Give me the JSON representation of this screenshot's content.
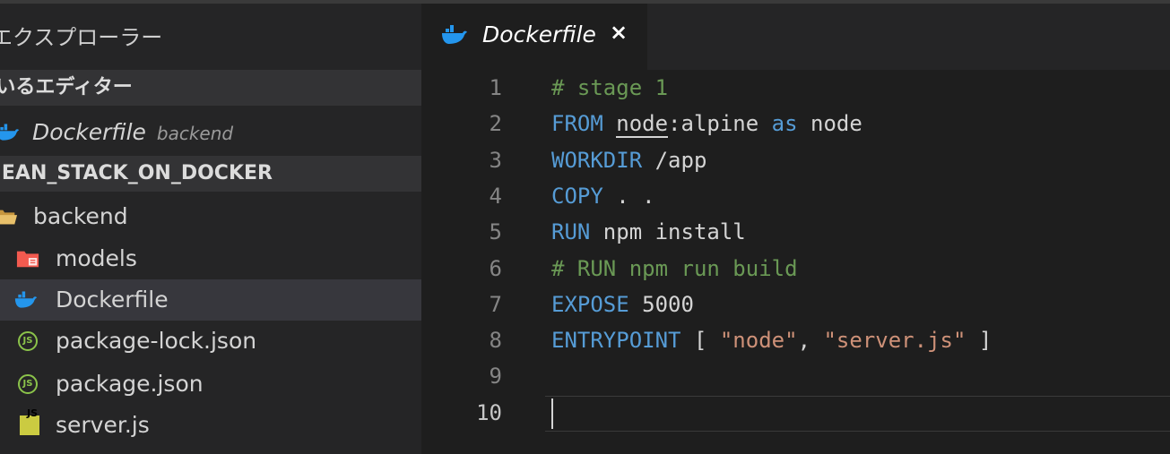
{
  "colors": {
    "keyword": "#569cd6",
    "comment": "#6a9955",
    "string": "#ce9178",
    "docker_icon": "#2496ed",
    "folder_icon": "#e8c06a",
    "models_folder_icon": "#f25a4f"
  },
  "sidebar": {
    "title": "エクスプローラー",
    "open_editors": {
      "header": "開いているエディター",
      "items": [
        {
          "label": "Dockerfile",
          "sub": "backend",
          "icon": "docker-icon"
        }
      ]
    },
    "project": {
      "header": "MEAN_STACK_ON_DOCKER",
      "tree": [
        {
          "label": "backend",
          "icon": "folder-open-icon"
        },
        {
          "label": "models",
          "icon": "folder-icon"
        },
        {
          "label": "Dockerfile",
          "icon": "docker-icon"
        },
        {
          "label": "package-lock.json",
          "icon": "json-icon"
        },
        {
          "label": "package.json",
          "icon": "json-icon"
        },
        {
          "label": "server.js",
          "icon": "js-icon"
        }
      ]
    }
  },
  "tab": {
    "label": "Dockerfile",
    "close": "×"
  },
  "editor": {
    "line_numbers": [
      "1",
      "2",
      "3",
      "4",
      "5",
      "6",
      "7",
      "8",
      "9",
      "10"
    ],
    "lines": [
      [
        {
          "t": "# stage 1",
          "c": "comment"
        }
      ],
      [
        {
          "t": "FROM",
          "c": "keyword"
        },
        {
          "t": " "
        },
        {
          "t": "node",
          "c": "underline"
        },
        {
          "t": ":alpine "
        },
        {
          "t": "as",
          "c": "keyword"
        },
        {
          "t": " node"
        }
      ],
      [
        {
          "t": "WORKDIR",
          "c": "keyword"
        },
        {
          "t": " /app"
        }
      ],
      [
        {
          "t": "COPY",
          "c": "keyword"
        },
        {
          "t": " . ."
        }
      ],
      [
        {
          "t": "RUN",
          "c": "keyword"
        },
        {
          "t": " npm install"
        }
      ],
      [
        {
          "t": "# RUN npm run build",
          "c": "comment"
        }
      ],
      [
        {
          "t": "EXPOSE",
          "c": "keyword"
        },
        {
          "t": " 5000"
        }
      ],
      [
        {
          "t": "ENTRYPOINT",
          "c": "keyword"
        },
        {
          "t": " [ "
        },
        {
          "t": "\"node\"",
          "c": "string"
        },
        {
          "t": ", "
        },
        {
          "t": "\"server.js\"",
          "c": "string"
        },
        {
          "t": " ]"
        }
      ],
      [],
      []
    ]
  }
}
